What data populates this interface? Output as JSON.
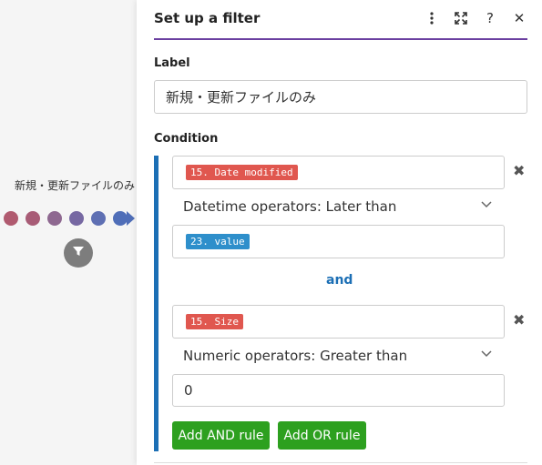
{
  "canvas": {
    "route_label": "新規・更新ファイルのみ",
    "dot_colors": [
      "#b05a6f",
      "#a85c76",
      "#8e6890",
      "#7668a2",
      "#5e6fb3",
      "#4f6eb8"
    ],
    "filter_icon": "funnel-icon"
  },
  "panel": {
    "title": "Set up a filter",
    "icons": [
      "more-vertical-icon",
      "expand-icon",
      "help-icon",
      "close-icon"
    ],
    "label_heading": "Label",
    "label_value": "新規・更新ファイルのみ",
    "condition_heading": "Condition",
    "rule1": {
      "field_pill": "15. Date modified",
      "operator": "Datetime operators: Later than",
      "value_pill": "23. value"
    },
    "connector": "and",
    "rule2": {
      "field_pill": "15. Size",
      "operator": "Numeric operators: Greater than",
      "value": "0"
    },
    "add_and_label": "Add AND rule",
    "add_or_label": "Add OR rule"
  },
  "colors": {
    "accent_purple": "#6b3fa0",
    "condition_blue": "#1c6fb5",
    "pill_red": "#e0574f",
    "pill_blue": "#2e8fcb",
    "button_green": "#2da01f"
  }
}
